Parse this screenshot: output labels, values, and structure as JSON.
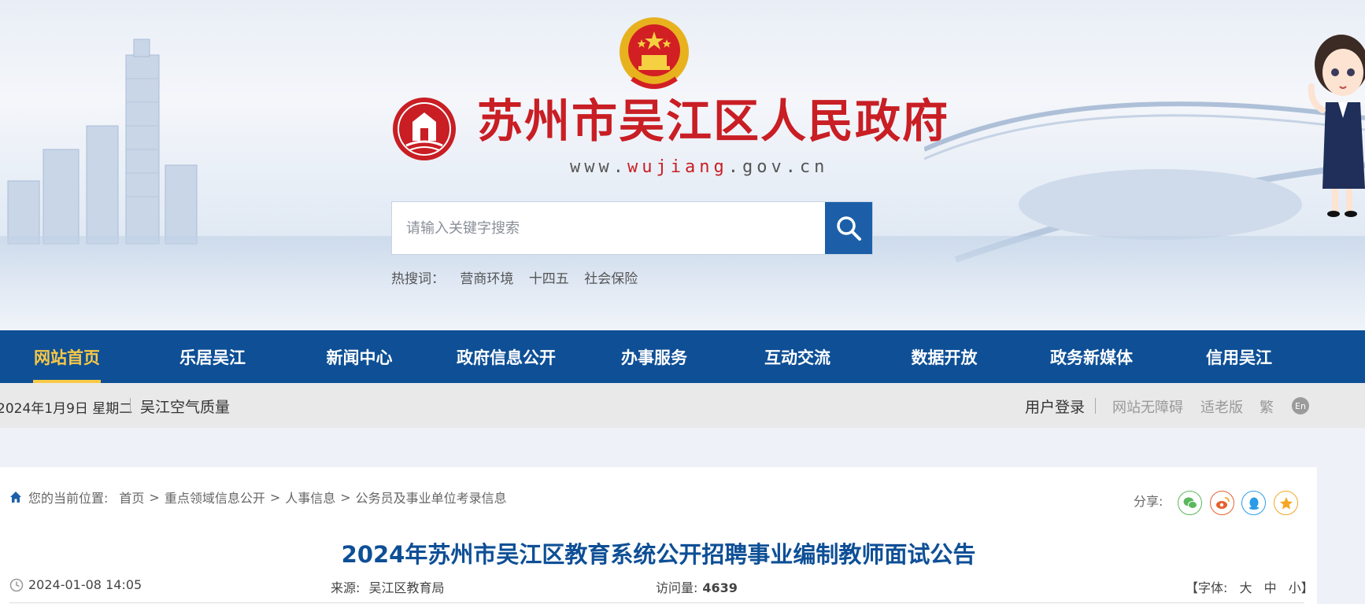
{
  "header": {
    "site_title": "苏州市吴江区人民政府",
    "site_url_prefix": "www.",
    "site_url_highlight": "wujiang",
    "site_url_suffix": ".gov.cn",
    "search_placeholder": "请输入关键字搜索",
    "hot_label": "热搜词：",
    "hot_words": [
      "营商环境",
      "十四五",
      "社会保险"
    ]
  },
  "nav": {
    "items": [
      "网站首页",
      "乐居吴江",
      "新闻中心",
      "政府信息公开",
      "办事服务",
      "互动交流",
      "数据开放",
      "政务新媒体",
      "信用吴江"
    ],
    "active": "网站首页"
  },
  "info_bar": {
    "date": "2024年1月9日 星期二",
    "air_quality": "吴江空气质量",
    "user_login": "用户登录",
    "accessibility": "网站无障碍",
    "elderly": "适老版",
    "traditional": "繁",
    "english": "En"
  },
  "breadcrumb": {
    "label": "您的当前位置:",
    "items": [
      "首页",
      "重点领域信息公开",
      "人事信息",
      "公务员及事业单位考录信息"
    ]
  },
  "share": {
    "label": "分享:"
  },
  "article": {
    "title": "2024年苏州市吴江区教育系统公开招聘事业编制教师面试公告",
    "datetime": "2024-01-08 14:05",
    "source_label": "来源:",
    "source": "吴江区教育局",
    "visits_label": "访问量:",
    "visits": "4639",
    "font_label": "【字体:",
    "font_large": "大",
    "font_medium": "中",
    "font_small": "小】"
  },
  "colors": {
    "brand_red": "#c81e24",
    "nav_blue": "#0e4f96",
    "nav_active": "#f9c846",
    "title_blue": "#0e4f96"
  }
}
